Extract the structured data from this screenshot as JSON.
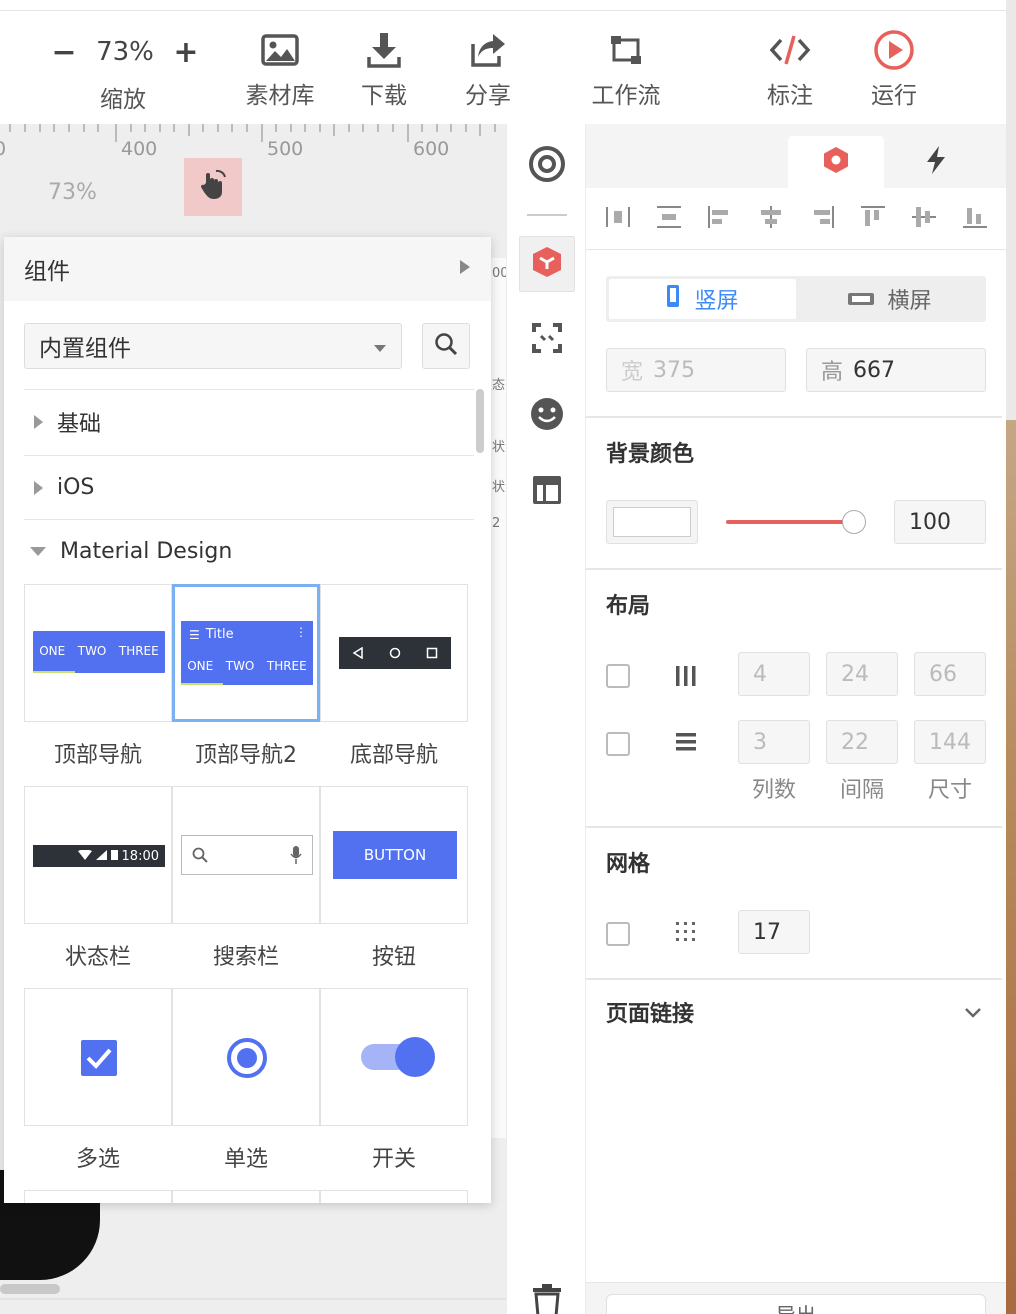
{
  "toolbar": {
    "zoom_value": "73%",
    "zoom_minus": "−",
    "zoom_plus": "+",
    "zoom_label": "缩放",
    "items": [
      {
        "label": "素材库",
        "icon": "image-icon"
      },
      {
        "label": "下载",
        "icon": "download-icon"
      },
      {
        "label": "分享",
        "icon": "share-icon"
      },
      {
        "label": "工作流",
        "icon": "workflow-icon"
      },
      {
        "label": "标注",
        "icon": "code-icon"
      },
      {
        "label": "运行",
        "icon": "play-icon"
      }
    ],
    "accent": "#e8605c"
  },
  "canvas": {
    "ruler_ticks": [
      "0",
      "400",
      "500",
      "600"
    ],
    "zoom_text": "73%",
    "frame_texts": [
      "00",
      "态",
      "状",
      "状",
      "2"
    ]
  },
  "component_panel": {
    "title": "组件",
    "select_value": "内置组件",
    "categories": [
      {
        "label": "基础",
        "expanded": false
      },
      {
        "label": "iOS",
        "expanded": false
      },
      {
        "label": "Material Design",
        "expanded": true
      }
    ],
    "tab_labels": [
      "ONE",
      "TWO",
      "THREE"
    ],
    "appbar_title": "Title",
    "status_time": "18:00",
    "button_text": "BUTTON",
    "items": [
      {
        "label": "顶部导航"
      },
      {
        "label": "顶部导航2"
      },
      {
        "label": "底部导航"
      },
      {
        "label": "状态栏"
      },
      {
        "label": "搜索栏"
      },
      {
        "label": "按钮"
      },
      {
        "label": "多选"
      },
      {
        "label": "单选"
      },
      {
        "label": "开关"
      }
    ],
    "material_color": "#5271f0"
  },
  "properties": {
    "orientation": {
      "portrait": "竖屏",
      "landscape": "横屏",
      "selected": "portrait"
    },
    "width": {
      "prefix": "宽",
      "value": "375"
    },
    "height": {
      "prefix": "高",
      "value": "667"
    },
    "bg_section": "背景颜色",
    "bg_opacity": "100",
    "layout_section": "布局",
    "layout_rows": [
      {
        "values": [
          "4",
          "24",
          "66"
        ]
      },
      {
        "values": [
          "3",
          "22",
          "144"
        ]
      }
    ],
    "layout_col_labels": [
      "列数",
      "间隔",
      "尺寸"
    ],
    "grid_section": "网格",
    "grid_value": "17",
    "page_link_section": "页面链接",
    "export_label": "导出"
  }
}
